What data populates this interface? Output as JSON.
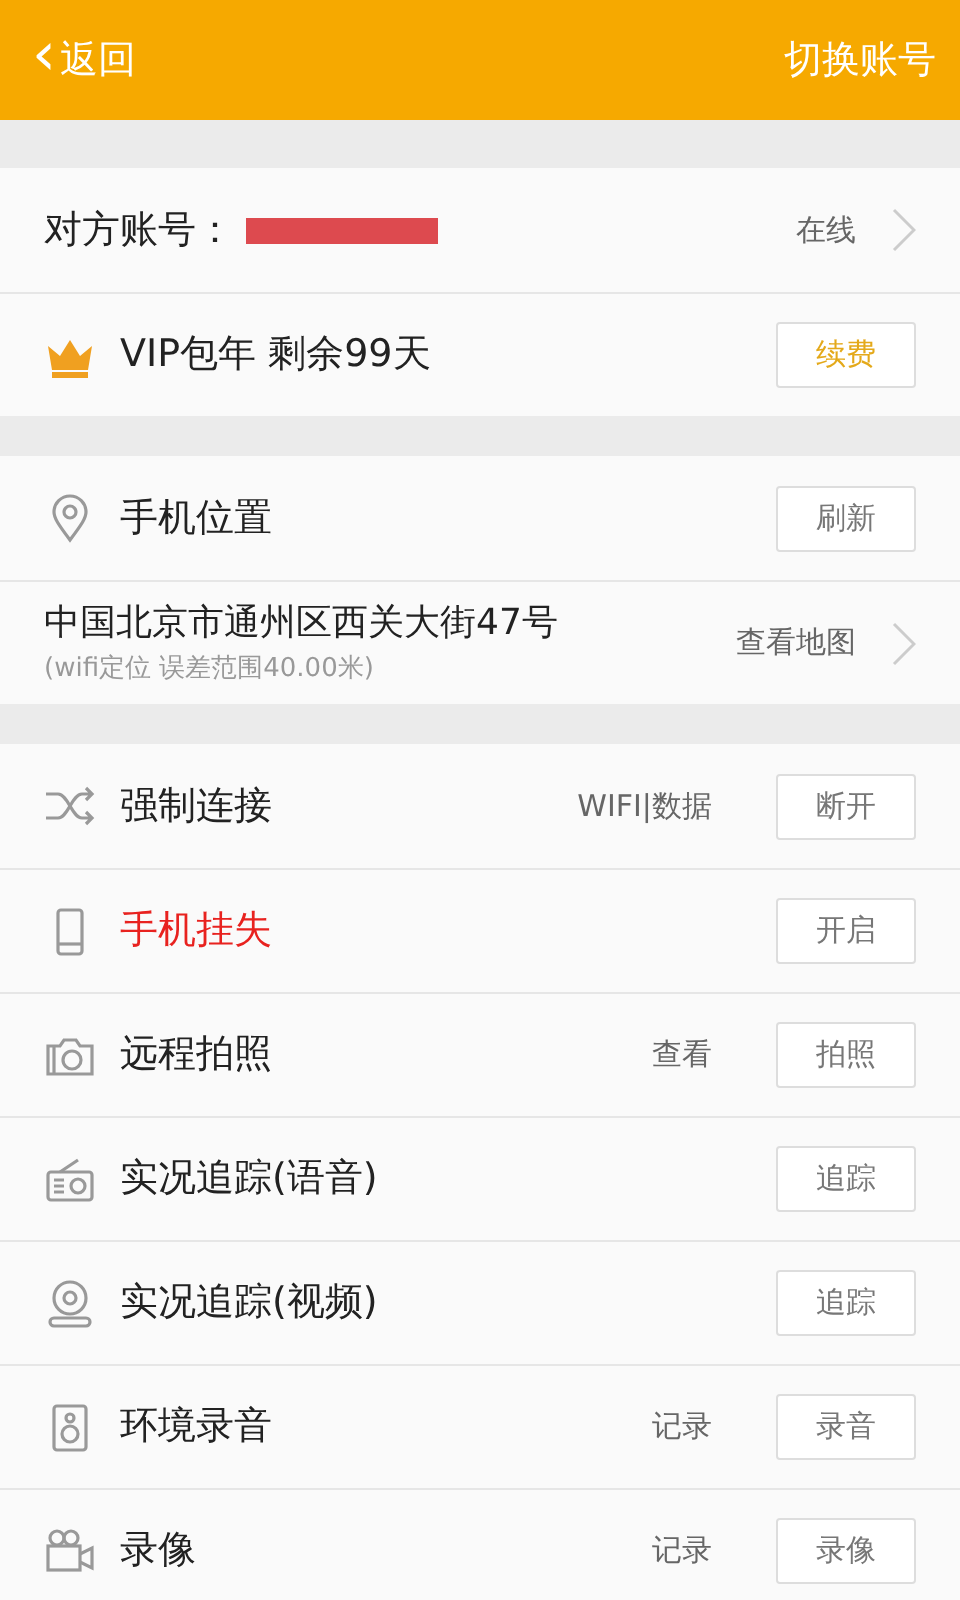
{
  "header": {
    "back": "返回",
    "back_icon": "‹",
    "action": "切换账号"
  },
  "account": {
    "label": "对方账号：",
    "redacted": true,
    "status": "在线"
  },
  "vip": {
    "text": "VIP包年 剩余99天",
    "button": "续费"
  },
  "location": {
    "title": "手机位置",
    "button": "刷新",
    "address": "中国北京市通州区西关大街47号",
    "detail": "(wifi定位 误差范围40.00米)",
    "link": "查看地图"
  },
  "features": [
    {
      "kind": "shuffle",
      "label": "强制连接",
      "alert": false,
      "link": "WIFI|数据",
      "button": "断开"
    },
    {
      "kind": "phone",
      "label": "手机挂失",
      "alert": true,
      "button": "开启"
    },
    {
      "kind": "camera",
      "label": "远程拍照",
      "alert": false,
      "link": "查看",
      "button": "拍照"
    },
    {
      "kind": "radio",
      "label": "实况追踪(语音)",
      "alert": false,
      "button": "追踪"
    },
    {
      "kind": "webcam",
      "label": "实况追踪(视频)",
      "alert": false,
      "button": "追踪"
    },
    {
      "kind": "speaker",
      "label": "环境录音",
      "alert": false,
      "link": "记录",
      "button": "录音"
    },
    {
      "kind": "video",
      "label": "录像",
      "alert": false,
      "link": "记录",
      "button": "录像"
    }
  ]
}
